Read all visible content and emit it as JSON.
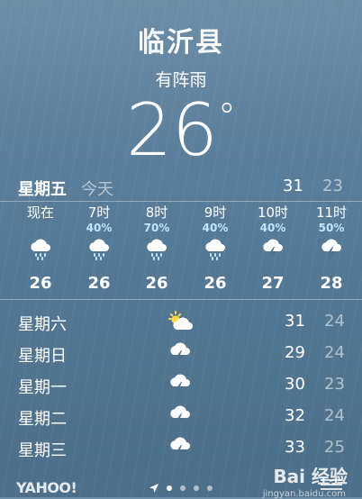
{
  "city": "临沂县",
  "condition": "有阵雨",
  "temperature": "26",
  "degree_symbol": "°",
  "today": {
    "day": "星期五",
    "label": "今天",
    "high": "31",
    "low": "23"
  },
  "hourly": [
    {
      "time": "现在",
      "precip": "",
      "icon": "rain-cloud-icon",
      "temp": "26"
    },
    {
      "time": "7时",
      "precip": "40%",
      "icon": "rain-cloud-icon",
      "temp": "26"
    },
    {
      "time": "8时",
      "precip": "70%",
      "icon": "rain-cloud-icon",
      "temp": "26"
    },
    {
      "time": "9时",
      "precip": "40%",
      "icon": "rain-cloud-icon",
      "temp": "26"
    },
    {
      "time": "10时",
      "precip": "40%",
      "icon": "thunderstorm-icon",
      "temp": "27"
    },
    {
      "time": "11时",
      "precip": "50%",
      "icon": "thunderstorm-icon",
      "temp": "28"
    }
  ],
  "daily": [
    {
      "day": "星期六",
      "icon": "partly-sunny-icon",
      "high": "31",
      "low": "24"
    },
    {
      "day": "星期日",
      "icon": "thunderstorm-icon",
      "high": "29",
      "low": "24"
    },
    {
      "day": "星期一",
      "icon": "thunderstorm-icon",
      "high": "30",
      "low": "23"
    },
    {
      "day": "星期二",
      "icon": "thunderstorm-icon",
      "high": "32",
      "low": "24"
    },
    {
      "day": "星期三",
      "icon": "thunderstorm-icon",
      "high": "33",
      "low": "25"
    }
  ],
  "footer": {
    "provider": "YAHOO!"
  },
  "watermark": {
    "text": "Bai 经验",
    "sub": "jingyan.baidu.com"
  },
  "colors": {
    "precip": "#bfe6ff",
    "background": "#5c7f9b"
  }
}
